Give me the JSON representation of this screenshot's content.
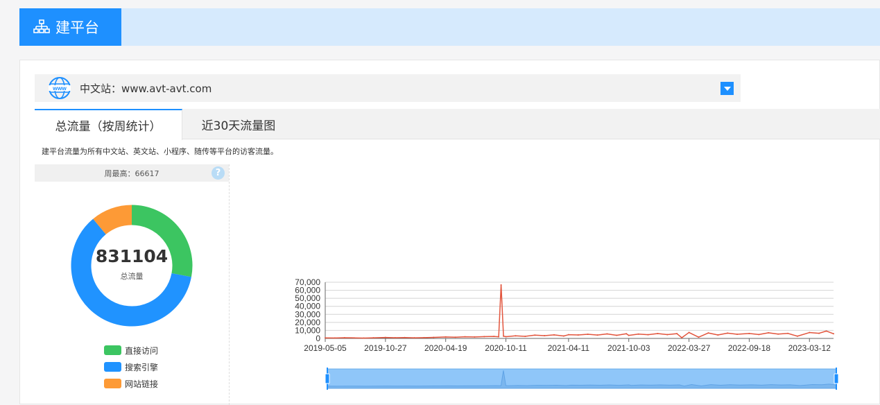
{
  "header": {
    "title": "建平台",
    "icon": "sitemap-icon"
  },
  "site_selector": {
    "icon": "www-globe-icon",
    "label": "中文站：www.avt-avt.com"
  },
  "tabs": [
    {
      "label": "总流量（按周统计）",
      "active": true
    },
    {
      "label": "近30天流量图",
      "active": false
    }
  ],
  "description": "建平台流量为所有中文站、英文站、小程序、随传等平台的访客流量。",
  "summary": {
    "peak_label": "周最高：66617",
    "help": "?"
  },
  "donut": {
    "total": "831104",
    "total_label": "总流量",
    "segments": [
      {
        "name": "直接访问",
        "color": "#3cc561",
        "fraction": 0.28
      },
      {
        "name": "搜索引擎",
        "color": "#2093ff",
        "fraction": 0.61
      },
      {
        "name": "网站链接",
        "color": "#fd9a36",
        "fraction": 0.11
      }
    ]
  },
  "chart_data": {
    "type": "line",
    "ylim": [
      0,
      70000
    ],
    "yticks": [
      "0",
      "10,000",
      "20,000",
      "30,000",
      "40,000",
      "50,000",
      "60,000",
      "70,000"
    ],
    "xticks": [
      "2019-05-05",
      "2019-10-27",
      "2020-04-19",
      "2020-10-11",
      "2021-04-11",
      "2021-10-03",
      "2022-03-27",
      "2022-09-18",
      "2023-03-12"
    ],
    "series": [
      {
        "color": "#e2543c",
        "x": [
          "2019-05-05",
          "2019-06-02",
          "2019-06-30",
          "2019-07-28",
          "2019-08-25",
          "2019-09-22",
          "2019-10-27",
          "2019-11-24",
          "2019-12-22",
          "2020-01-19",
          "2020-02-16",
          "2020-03-15",
          "2020-04-19",
          "2020-05-17",
          "2020-06-14",
          "2020-07-12",
          "2020-08-09",
          "2020-09-06",
          "2020-09-20",
          "2020-09-27",
          "2020-10-04",
          "2020-10-11",
          "2020-11-08",
          "2020-12-06",
          "2021-01-03",
          "2021-01-31",
          "2021-02-28",
          "2021-03-28",
          "2021-04-11",
          "2021-05-09",
          "2021-06-06",
          "2021-07-04",
          "2021-08-01",
          "2021-08-29",
          "2021-09-26",
          "2021-10-03",
          "2021-10-31",
          "2021-11-28",
          "2021-12-26",
          "2022-01-23",
          "2022-02-20",
          "2022-03-06",
          "2022-03-27",
          "2022-04-24",
          "2022-05-22",
          "2022-06-19",
          "2022-07-17",
          "2022-08-14",
          "2022-09-18",
          "2022-10-16",
          "2022-11-13",
          "2022-12-11",
          "2023-01-08",
          "2023-02-05",
          "2023-03-12",
          "2023-04-09",
          "2023-04-30",
          "2023-05-21"
        ],
        "values": [
          600,
          500,
          900,
          700,
          400,
          800,
          1200,
          900,
          1100,
          800,
          1000,
          1300,
          1800,
          1500,
          2000,
          1800,
          2300,
          2500,
          2100,
          66617,
          2800,
          2200,
          3200,
          2600,
          4100,
          3500,
          4400,
          3000,
          4600,
          4300,
          5200,
          4200,
          5600,
          3900,
          5800,
          3800,
          5400,
          4600,
          6000,
          4800,
          5900,
          900,
          7400,
          1600,
          6800,
          4300,
          6600,
          5200,
          6200,
          4900,
          7000,
          5400,
          6300,
          2800,
          7300,
          6400,
          9200,
          5800
        ]
      }
    ]
  }
}
